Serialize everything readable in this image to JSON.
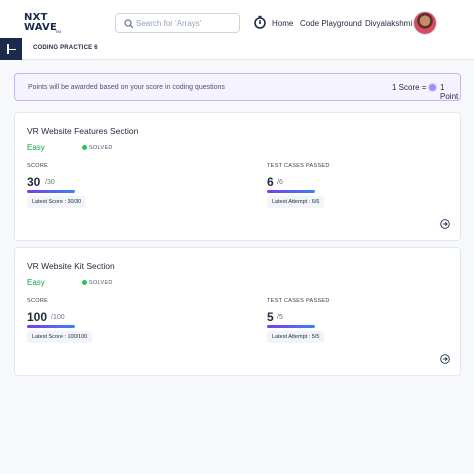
{
  "header": {
    "logo_line1": "NXT",
    "logo_line2": "WAVE",
    "logo_tm": "TM",
    "search_placeholder": "Search for 'Arrays'",
    "nav": {
      "home": "Home",
      "playground": "Code Playground",
      "user": "Divyalakshmi"
    }
  },
  "subheader": {
    "title": "CODING PRACTICE 6"
  },
  "notice": {
    "text": "Points will be awarded based on your score in coding questions",
    "score_label": "1 Score =",
    "point_label": "1 Point"
  },
  "cards": [
    {
      "title": "VR Website Features Section",
      "difficulty": "Easy",
      "status": "SOLVED",
      "score_label": "SCORE",
      "score": "30",
      "score_max": "/30",
      "score_fraction": 1.0,
      "tests_label": "TEST CASES PASSED",
      "tests": "6",
      "tests_max": "/6",
      "tests_fraction": 1.0,
      "latest_score": "Latest Score : 30/30",
      "latest_attempt": "Latest Attempt : 6/6"
    },
    {
      "title": "VR Website Kit Section",
      "difficulty": "Easy",
      "status": "SOLVED",
      "score_label": "SCORE",
      "score": "100",
      "score_max": "/100",
      "score_fraction": 1.0,
      "tests_label": "TEST CASES PASSED",
      "tests": "5",
      "tests_max": "/5",
      "tests_fraction": 1.0,
      "latest_score": "Latest Score : 100/100",
      "latest_attempt": "Latest Attempt : 5/5"
    }
  ],
  "colors": {
    "brand_dark": "#1b2b4d",
    "accent_purple": "#7c3aed",
    "accent_blue": "#3b82f6",
    "success": "#16a34a",
    "notice_bg": "#f5f3ff"
  },
  "icons": {
    "search": "search-icon",
    "stopwatch": "stopwatch-icon",
    "collapse": "sidebar-collapse-icon",
    "coin": "coin-icon",
    "arrow": "arrow-right-circle-icon"
  }
}
